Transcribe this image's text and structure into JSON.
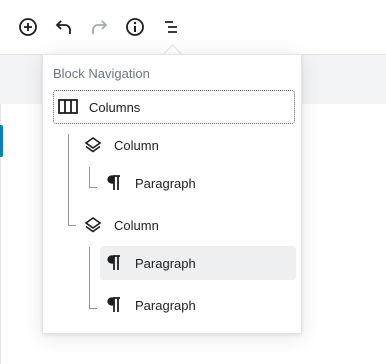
{
  "toolbar": {
    "buttons": [
      {
        "name": "add-block",
        "icon": "plus-circle-icon",
        "enabled": true
      },
      {
        "name": "undo",
        "icon": "undo-icon",
        "enabled": true
      },
      {
        "name": "redo",
        "icon": "redo-icon",
        "enabled": false
      },
      {
        "name": "content-structure",
        "icon": "info-icon",
        "enabled": true
      },
      {
        "name": "block-navigation",
        "icon": "block-navigation-icon",
        "enabled": true
      }
    ]
  },
  "block_navigation": {
    "title": "Block Navigation",
    "items": [
      {
        "label": "Columns",
        "icon": "columns-icon",
        "level": 0,
        "state": "focused"
      },
      {
        "label": "Column",
        "icon": "column-icon",
        "level": 1,
        "state": "normal"
      },
      {
        "label": "Paragraph",
        "icon": "paragraph-icon",
        "level": 2,
        "state": "normal"
      },
      {
        "label": "Column",
        "icon": "column-icon",
        "level": 1,
        "state": "normal"
      },
      {
        "label": "Paragraph",
        "icon": "paragraph-icon",
        "level": 2,
        "state": "selected"
      },
      {
        "label": "Paragraph",
        "icon": "paragraph-icon",
        "level": 2,
        "state": "normal"
      }
    ]
  },
  "colors": {
    "icon_enabled": "#1e1e1e",
    "icon_disabled": "#a2aab2",
    "selected_bg": "#edeff0",
    "accent_blue": "#0085ba"
  }
}
